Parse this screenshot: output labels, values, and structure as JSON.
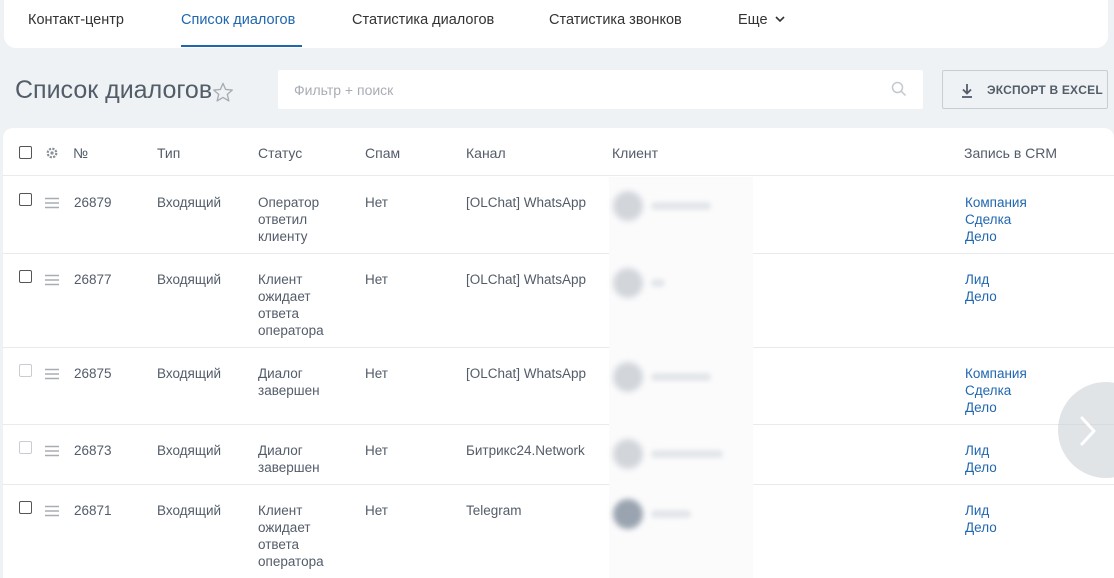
{
  "nav": {
    "tabs": [
      {
        "label": "Контакт-центр"
      },
      {
        "label": "Список диалогов"
      },
      {
        "label": "Статистика диалогов"
      },
      {
        "label": "Статистика звонков"
      },
      {
        "label": "Еще"
      }
    ],
    "active_tab": "Список диалогов"
  },
  "page": {
    "title": "Список диалогов",
    "search_placeholder": "Фильтр + поиск",
    "export_label": "ЭКСПОРТ В EXCEL"
  },
  "table": {
    "columns": {
      "num": "№",
      "type": "Тип",
      "status": "Статус",
      "spam": "Спам",
      "channel": "Канал",
      "client": "Клиент",
      "crm": "Запись в CRM"
    },
    "rows": [
      {
        "num": "26879",
        "type": "Входящий",
        "status": [
          "Оператор",
          "ответил",
          "клиенту"
        ],
        "spam": "Нет",
        "channel": "[OLChat] WhatsApp",
        "crm": [
          "Компания",
          "Сделка",
          "Дело"
        ]
      },
      {
        "num": "26877",
        "type": "Входящий",
        "status": [
          "Клиент",
          "ожидает",
          "ответа",
          "оператора"
        ],
        "spam": "Нет",
        "channel": "[OLChat] WhatsApp",
        "crm": [
          "Лид",
          "Дело"
        ]
      },
      {
        "num": "26875",
        "type": "Входящий",
        "status": [
          "Диалог",
          "завершен"
        ],
        "spam": "Нет",
        "channel": "[OLChat] WhatsApp",
        "crm": [
          "Компания",
          "Сделка",
          "Дело"
        ]
      },
      {
        "num": "26873",
        "type": "Входящий",
        "status": [
          "Диалог",
          "завершен"
        ],
        "spam": "Нет",
        "channel": "Битрикс24.Network",
        "crm": [
          "Лид",
          "Дело"
        ]
      },
      {
        "num": "26871",
        "type": "Входящий",
        "status": [
          "Клиент",
          "ожидает",
          "ответа",
          "оператора"
        ],
        "spam": "Нет",
        "channel": "Telegram",
        "crm": [
          "Лид",
          "Дело"
        ]
      }
    ]
  },
  "colors": {
    "accent": "#2067b0",
    "background": "#eef2f4",
    "text": "#535c69"
  },
  "icons": [
    "chevron-down-icon",
    "star-icon",
    "search-icon",
    "download-icon",
    "gear-icon",
    "drag-handle-icon",
    "chevron-right-icon"
  ]
}
